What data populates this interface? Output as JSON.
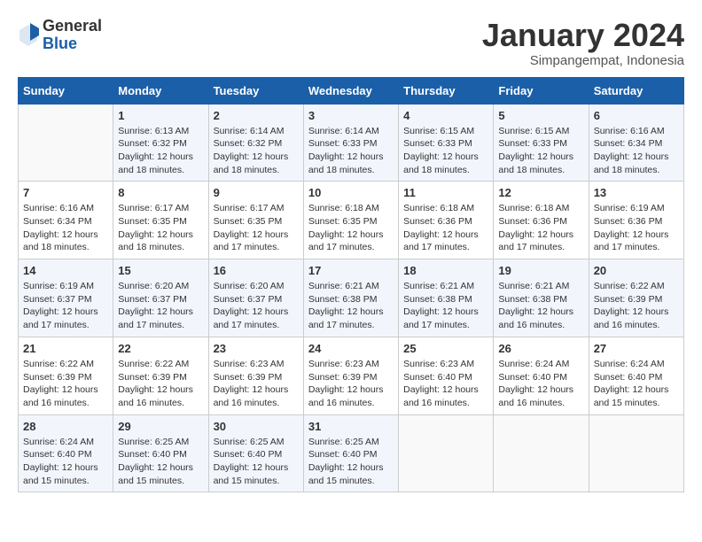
{
  "logo": {
    "general": "General",
    "blue": "Blue"
  },
  "header": {
    "month": "January 2024",
    "location": "Simpangempat, Indonesia"
  },
  "weekdays": [
    "Sunday",
    "Monday",
    "Tuesday",
    "Wednesday",
    "Thursday",
    "Friday",
    "Saturday"
  ],
  "weeks": [
    [
      {
        "day": "",
        "info": ""
      },
      {
        "day": "1",
        "info": "Sunrise: 6:13 AM\nSunset: 6:32 PM\nDaylight: 12 hours and 18 minutes."
      },
      {
        "day": "2",
        "info": "Sunrise: 6:14 AM\nSunset: 6:32 PM\nDaylight: 12 hours and 18 minutes."
      },
      {
        "day": "3",
        "info": "Sunrise: 6:14 AM\nSunset: 6:33 PM\nDaylight: 12 hours and 18 minutes."
      },
      {
        "day": "4",
        "info": "Sunrise: 6:15 AM\nSunset: 6:33 PM\nDaylight: 12 hours and 18 minutes."
      },
      {
        "day": "5",
        "info": "Sunrise: 6:15 AM\nSunset: 6:33 PM\nDaylight: 12 hours and 18 minutes."
      },
      {
        "day": "6",
        "info": "Sunrise: 6:16 AM\nSunset: 6:34 PM\nDaylight: 12 hours and 18 minutes."
      }
    ],
    [
      {
        "day": "7",
        "info": "Sunrise: 6:16 AM\nSunset: 6:34 PM\nDaylight: 12 hours and 18 minutes."
      },
      {
        "day": "8",
        "info": "Sunrise: 6:17 AM\nSunset: 6:35 PM\nDaylight: 12 hours and 18 minutes."
      },
      {
        "day": "9",
        "info": "Sunrise: 6:17 AM\nSunset: 6:35 PM\nDaylight: 12 hours and 17 minutes."
      },
      {
        "day": "10",
        "info": "Sunrise: 6:18 AM\nSunset: 6:35 PM\nDaylight: 12 hours and 17 minutes."
      },
      {
        "day": "11",
        "info": "Sunrise: 6:18 AM\nSunset: 6:36 PM\nDaylight: 12 hours and 17 minutes."
      },
      {
        "day": "12",
        "info": "Sunrise: 6:18 AM\nSunset: 6:36 PM\nDaylight: 12 hours and 17 minutes."
      },
      {
        "day": "13",
        "info": "Sunrise: 6:19 AM\nSunset: 6:36 PM\nDaylight: 12 hours and 17 minutes."
      }
    ],
    [
      {
        "day": "14",
        "info": "Sunrise: 6:19 AM\nSunset: 6:37 PM\nDaylight: 12 hours and 17 minutes."
      },
      {
        "day": "15",
        "info": "Sunrise: 6:20 AM\nSunset: 6:37 PM\nDaylight: 12 hours and 17 minutes."
      },
      {
        "day": "16",
        "info": "Sunrise: 6:20 AM\nSunset: 6:37 PM\nDaylight: 12 hours and 17 minutes."
      },
      {
        "day": "17",
        "info": "Sunrise: 6:21 AM\nSunset: 6:38 PM\nDaylight: 12 hours and 17 minutes."
      },
      {
        "day": "18",
        "info": "Sunrise: 6:21 AM\nSunset: 6:38 PM\nDaylight: 12 hours and 17 minutes."
      },
      {
        "day": "19",
        "info": "Sunrise: 6:21 AM\nSunset: 6:38 PM\nDaylight: 12 hours and 16 minutes."
      },
      {
        "day": "20",
        "info": "Sunrise: 6:22 AM\nSunset: 6:39 PM\nDaylight: 12 hours and 16 minutes."
      }
    ],
    [
      {
        "day": "21",
        "info": "Sunrise: 6:22 AM\nSunset: 6:39 PM\nDaylight: 12 hours and 16 minutes."
      },
      {
        "day": "22",
        "info": "Sunrise: 6:22 AM\nSunset: 6:39 PM\nDaylight: 12 hours and 16 minutes."
      },
      {
        "day": "23",
        "info": "Sunrise: 6:23 AM\nSunset: 6:39 PM\nDaylight: 12 hours and 16 minutes."
      },
      {
        "day": "24",
        "info": "Sunrise: 6:23 AM\nSunset: 6:39 PM\nDaylight: 12 hours and 16 minutes."
      },
      {
        "day": "25",
        "info": "Sunrise: 6:23 AM\nSunset: 6:40 PM\nDaylight: 12 hours and 16 minutes."
      },
      {
        "day": "26",
        "info": "Sunrise: 6:24 AM\nSunset: 6:40 PM\nDaylight: 12 hours and 16 minutes."
      },
      {
        "day": "27",
        "info": "Sunrise: 6:24 AM\nSunset: 6:40 PM\nDaylight: 12 hours and 15 minutes."
      }
    ],
    [
      {
        "day": "28",
        "info": "Sunrise: 6:24 AM\nSunset: 6:40 PM\nDaylight: 12 hours and 15 minutes."
      },
      {
        "day": "29",
        "info": "Sunrise: 6:25 AM\nSunset: 6:40 PM\nDaylight: 12 hours and 15 minutes."
      },
      {
        "day": "30",
        "info": "Sunrise: 6:25 AM\nSunset: 6:40 PM\nDaylight: 12 hours and 15 minutes."
      },
      {
        "day": "31",
        "info": "Sunrise: 6:25 AM\nSunset: 6:40 PM\nDaylight: 12 hours and 15 minutes."
      },
      {
        "day": "",
        "info": ""
      },
      {
        "day": "",
        "info": ""
      },
      {
        "day": "",
        "info": ""
      }
    ]
  ]
}
